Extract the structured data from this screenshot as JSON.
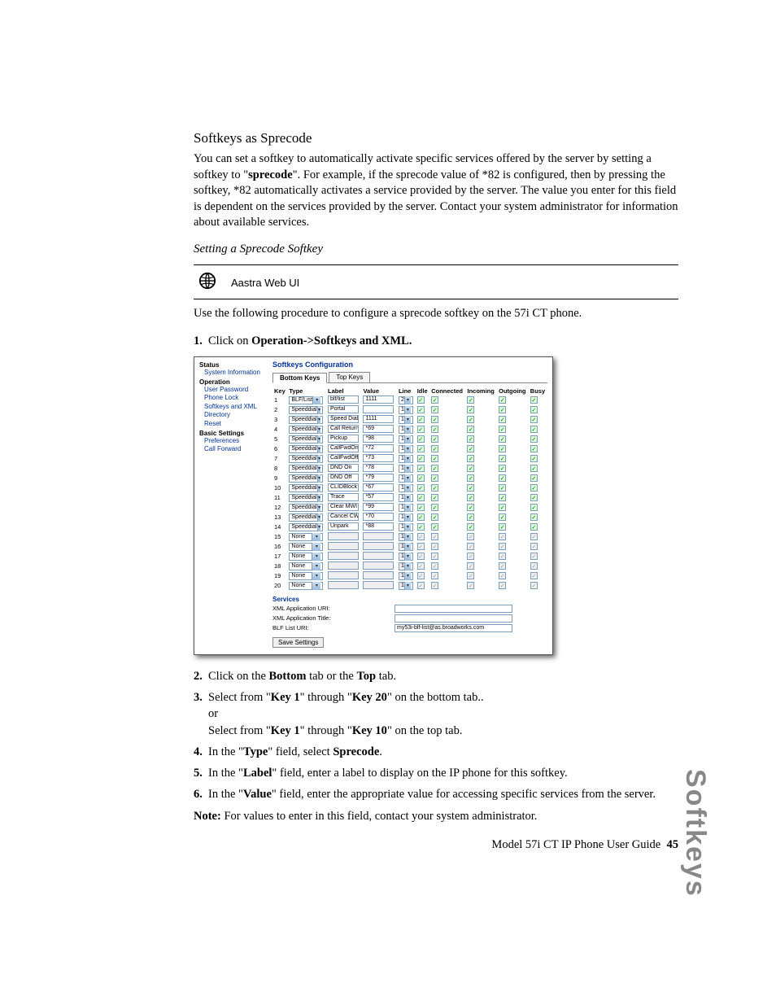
{
  "section_title": "Softkeys as Sprecode",
  "intro": "You can set a softkey to automatically activate specific services offered by the server by setting a softkey to \"sprecode\". For example, if the sprecode value of *82 is configured, then by pressing the softkey, *82 automatically activates a service provided by the server. The value you enter for this field is dependent on the services provided by the server. Contact your system administrator for information about available services.",
  "intro_bold_word": "sprecode",
  "subsection_title": "Setting a Sprecode Softkey",
  "aastra_label": "Aastra Web UI",
  "procedure_intro": "Use the following procedure to configure a sprecode softkey on the 57i CT phone.",
  "steps": {
    "1": {
      "pre": "Click on ",
      "bold": "Operation->Softkeys and XML.",
      "post": ""
    },
    "2": {
      "pre": "Click on the ",
      "bold": "Bottom",
      "mid": " tab or the ",
      "bold2": "Top",
      "post": " tab."
    },
    "3": {
      "pre": "Select from \"",
      "bold": "Key 1",
      "mid": "\" through \"",
      "bold2": "Key 20",
      "post": "\" on the bottom tab..",
      "or": "or",
      "pre2": "Select from \"",
      "bold3": "Key 1",
      "mid2": "\" through \"",
      "bold4": "Key 10",
      "post2": "\" on the top tab."
    },
    "4": {
      "pre": "In the \"",
      "bold": "Type",
      "mid": "\" field, select ",
      "bold2": "Sprecode",
      "post": "."
    },
    "5": {
      "pre": "In the \"",
      "bold": "Label",
      "post": "\" field, enter a label to display on the IP phone for this softkey."
    },
    "6": {
      "pre": "In the \"",
      "bold": "Value",
      "post": "\" field, enter the appropriate value for accessing specific services from the server."
    }
  },
  "note_label": "Note:",
  "note_text": " For values to enter in this field, contact your system administrator.",
  "footer": "Model 57i CT IP Phone User Guide",
  "page_number": "45",
  "side_label": "Softkeys",
  "ui": {
    "nav": {
      "status": "Status",
      "sysinfo": "System Information",
      "operation": "Operation",
      "userpw": "User Password",
      "phonelock": "Phone Lock",
      "softkeys": "Softkeys and XML",
      "directory": "Directory",
      "reset": "Reset",
      "basic": "Basic Settings",
      "prefs": "Preferences",
      "callfwd": "Call Forward"
    },
    "title": "Softkeys Configuration",
    "tabs": {
      "bottom": "Bottom Keys",
      "top": "Top Keys"
    },
    "headers": [
      "Key",
      "Type",
      "Label",
      "Value",
      "Line",
      "Idle",
      "Connected",
      "Incoming",
      "Outgoing",
      "Busy"
    ],
    "rows": [
      {
        "key": "1",
        "type": "BLF/List",
        "label": "blf/list",
        "value": "1111",
        "line": "2",
        "active": true
      },
      {
        "key": "2",
        "type": "Speeddial",
        "label": "Portal",
        "value": "",
        "line": "1",
        "active": true
      },
      {
        "key": "3",
        "type": "Speeddial",
        "label": "Speed Dial",
        "value": "1111",
        "line": "1",
        "active": true
      },
      {
        "key": "4",
        "type": "Speeddial",
        "label": "Call Return",
        "value": "*69",
        "line": "1",
        "active": true
      },
      {
        "key": "5",
        "type": "Speeddial",
        "label": "Pickup",
        "value": "*98",
        "line": "1",
        "active": true
      },
      {
        "key": "6",
        "type": "Speeddial",
        "label": "CallFwdOn",
        "value": "*72",
        "line": "1",
        "active": true
      },
      {
        "key": "7",
        "type": "Speeddial",
        "label": "CallFwdOff",
        "value": "*73",
        "line": "1",
        "active": true
      },
      {
        "key": "8",
        "type": "Speeddial",
        "label": "DND On",
        "value": "*78",
        "line": "1",
        "active": true
      },
      {
        "key": "9",
        "type": "Speeddial",
        "label": "DND Off",
        "value": "*79",
        "line": "1",
        "active": true
      },
      {
        "key": "10",
        "type": "Speeddial",
        "label": "CLIDBlock",
        "value": "*67",
        "line": "1",
        "active": true
      },
      {
        "key": "11",
        "type": "Speeddial",
        "label": "Trace",
        "value": "*57",
        "line": "1",
        "active": true
      },
      {
        "key": "12",
        "type": "Speeddial",
        "label": "Clear MWI",
        "value": "*99",
        "line": "1",
        "active": true
      },
      {
        "key": "13",
        "type": "Speeddial",
        "label": "Cancel CW",
        "value": "*70",
        "line": "1",
        "active": true
      },
      {
        "key": "14",
        "type": "Speeddial",
        "label": "Unpark",
        "value": "*88",
        "line": "1",
        "active": true
      },
      {
        "key": "15",
        "type": "None",
        "label": "",
        "value": "",
        "line": "1",
        "active": false
      },
      {
        "key": "16",
        "type": "None",
        "label": "",
        "value": "",
        "line": "1",
        "active": false
      },
      {
        "key": "17",
        "type": "None",
        "label": "",
        "value": "",
        "line": "1",
        "active": false
      },
      {
        "key": "18",
        "type": "None",
        "label": "",
        "value": "",
        "line": "1",
        "active": false
      },
      {
        "key": "19",
        "type": "None",
        "label": "",
        "value": "",
        "line": "1",
        "active": false
      },
      {
        "key": "20",
        "type": "None",
        "label": "",
        "value": "",
        "line": "1",
        "active": false
      }
    ],
    "services_title": "Services",
    "xml_uri": "XML Application URI:",
    "xml_title": "XML Application Title:",
    "blf_uri": "BLF List URI:",
    "blf_value": "my53i-blf-list@as.broadworks.com",
    "save": "Save Settings"
  }
}
